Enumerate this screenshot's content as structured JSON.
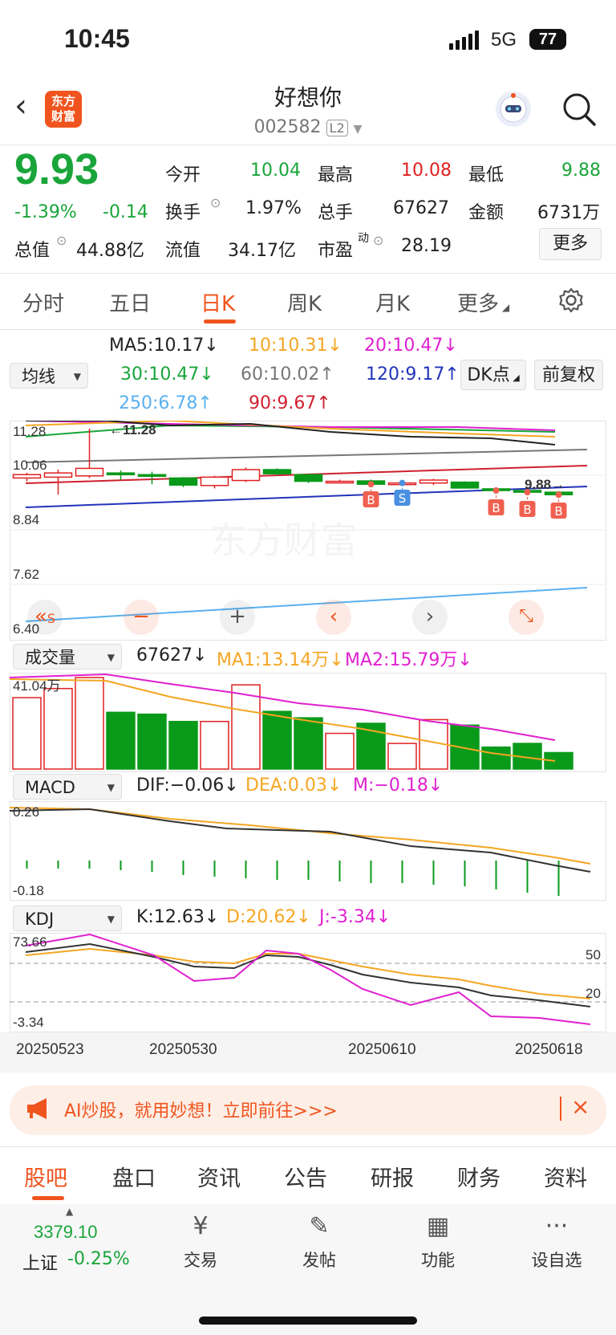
{
  "status": {
    "time": "10:45",
    "network": "5G",
    "battery": "77"
  },
  "header": {
    "title": "好想你",
    "code": "002582",
    "level": "L2",
    "logo_text": "东方\n财富"
  },
  "quote": {
    "price": "9.93",
    "change_pct": "-1.39%",
    "change": "-0.14",
    "open_label": "今开",
    "open": "10.04",
    "high_label": "最高",
    "high": "10.08",
    "low_label": "最低",
    "low": "9.88",
    "turnover_label": "换手",
    "turnover": "1.97%",
    "volume_label": "总手",
    "volume": "67627",
    "amount_label": "金额",
    "amount": "6731万",
    "mktcap_label": "总值",
    "mktcap": "44.88亿",
    "float_label": "流值",
    "float": "34.17亿",
    "pe_label": "市盈",
    "pe_sup": "动",
    "pe": "28.19",
    "more": "更多"
  },
  "tabs": [
    "分时",
    "五日",
    "日K",
    "周K",
    "月K",
    "更多"
  ],
  "active_tab": "日K",
  "ma": {
    "select": "均线",
    "ma5": "MA5:10.17↓",
    "ma10": "10:10.31↓",
    "ma20": "20:10.47↓",
    "ma30": "30:10.47↓",
    "ma60": "60:10.02↑",
    "ma120": "120:9.17↑",
    "ma250": "250:6.78↑",
    "ma90": "90:9.67↑",
    "dk": "DK点",
    "fq": "前复权"
  },
  "main_chart": {
    "y_ticks": [
      "11.28",
      "10.06",
      "8.84",
      "7.62",
      "6.40"
    ],
    "max_label": "←11.28",
    "min_label": "9.88→",
    "candles": [
      {
        "o": 10.1,
        "c": 10.18,
        "h": 10.22,
        "l": 10.02
      },
      {
        "o": 10.12,
        "c": 10.22,
        "h": 10.3,
        "l": 9.7
      },
      {
        "o": 10.15,
        "c": 10.33,
        "h": 11.28,
        "l": 10.1
      },
      {
        "o": 10.22,
        "c": 10.18,
        "h": 10.28,
        "l": 10.05
      },
      {
        "o": 10.18,
        "c": 10.14,
        "h": 10.25,
        "l": 9.95
      },
      {
        "o": 10.1,
        "c": 9.93,
        "h": 10.12,
        "l": 9.88
      },
      {
        "o": 9.92,
        "c": 10.12,
        "h": 10.15,
        "l": 9.85
      },
      {
        "o": 10.04,
        "c": 10.3,
        "h": 10.35,
        "l": 10.0
      },
      {
        "o": 10.3,
        "c": 10.2,
        "h": 10.33,
        "l": 10.16
      },
      {
        "o": 10.18,
        "c": 10.02,
        "h": 10.2,
        "l": 9.98
      },
      {
        "o": 10.0,
        "c": 10.02,
        "h": 10.06,
        "l": 9.98
      },
      {
        "o": 10.03,
        "c": 9.95,
        "h": 10.06,
        "l": 9.92
      },
      {
        "o": 9.95,
        "c": 9.98,
        "h": 10.0,
        "l": 9.92
      },
      {
        "o": 9.98,
        "c": 10.05,
        "h": 10.08,
        "l": 9.93
      },
      {
        "o": 10.0,
        "c": 9.86,
        "h": 10.02,
        "l": 9.85
      },
      {
        "o": 9.84,
        "c": 9.8,
        "h": 9.86,
        "l": 9.78
      },
      {
        "o": 9.8,
        "c": 9.76,
        "h": 9.82,
        "l": 9.74
      },
      {
        "o": 9.76,
        "c": 9.7,
        "h": 9.79,
        "l": 9.66
      }
    ],
    "signals": [
      {
        "i": 11,
        "t": "B"
      },
      {
        "i": 12,
        "t": "S"
      },
      {
        "i": 15,
        "t": "B"
      },
      {
        "i": 16,
        "t": "B"
      },
      {
        "i": 17,
        "t": "B"
      }
    ]
  },
  "volume": {
    "select": "成交量",
    "value": "67627↓",
    "ma1": "MA1:13.14万↓",
    "ma2": "MA2:15.79万↓",
    "top": "41.04万"
  },
  "macd": {
    "select": "MACD",
    "dif": "DIF:−0.06↓",
    "dea": "DEA:0.03↓",
    "m": "M:−0.18↓",
    "top": "0.26",
    "bottom": "-0.18"
  },
  "kdj": {
    "select": "KDJ",
    "k": "K:12.63↓",
    "d": "D:20.62↓",
    "j": "J:-3.34↓",
    "top": "73.66",
    "bottom": "-3.34",
    "l50": "50",
    "l20": "20"
  },
  "dates": [
    "20250523",
    "20250530",
    "20250610",
    "20250618"
  ],
  "banner": {
    "text": "AI炒股，就用妙想！立即前往>>>"
  },
  "bottom_tabs": [
    "股吧",
    "盘口",
    "资讯",
    "公告",
    "研报",
    "财务",
    "资料"
  ],
  "index": {
    "value": "3379.10",
    "name": "上证",
    "change": "-0.25%"
  },
  "nav": [
    {
      "icon": "¥",
      "label": "交易"
    },
    {
      "icon": "✎",
      "label": "发帖"
    },
    {
      "icon": "▦",
      "label": "功能"
    },
    {
      "icon": "···",
      "label": "设自选"
    }
  ],
  "colors": {
    "up": "#e02020",
    "down": "#0a9a1a",
    "accent": "#f0541e",
    "ma5": "#222222",
    "ma10": "#f5a623",
    "ma20": "#e020d0",
    "ma30": "#1aa53a",
    "ma60": "#777777",
    "ma120": "#2233bb",
    "ma250": "#5ab0f0",
    "ma90": "#d02030"
  }
}
